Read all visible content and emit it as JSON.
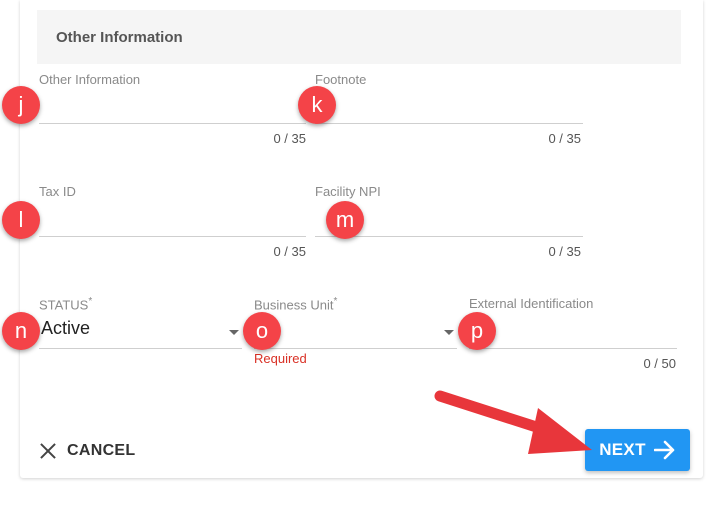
{
  "section": {
    "title": "Other Information"
  },
  "fields": {
    "other_information": {
      "label": "Other Information",
      "counter": "0 / 35"
    },
    "footnote": {
      "label": "Footnote",
      "counter": "0 / 35"
    },
    "tax_id": {
      "label": "Tax ID",
      "counter": "0 / 35"
    },
    "facility_npi": {
      "label": "Facility NPI",
      "counter": "0 / 35"
    },
    "status": {
      "label": "STATUS",
      "required_mark": "*",
      "value": "Active"
    },
    "business_unit": {
      "label": "Business Unit",
      "required_mark": "*",
      "error": "Required"
    },
    "external_identification": {
      "label": "External Identification",
      "counter": "0 / 50"
    }
  },
  "markers": [
    "j",
    "k",
    "l",
    "m",
    "n",
    "o",
    "p"
  ],
  "actions": {
    "cancel_label": "CANCEL",
    "next_label": "NEXT"
  },
  "colors": {
    "accent": "#2196f3",
    "marker": "#f44348",
    "error": "#d93025",
    "arrow": "#e8363b"
  }
}
